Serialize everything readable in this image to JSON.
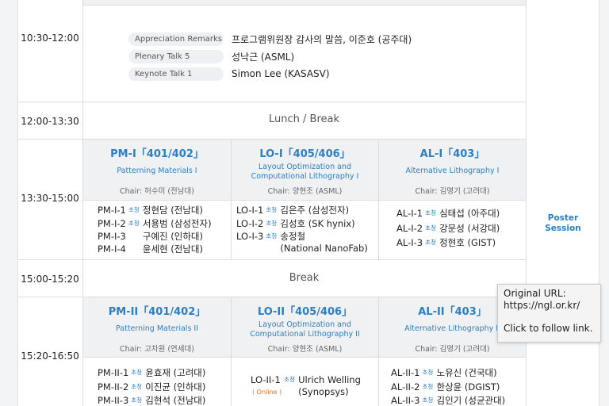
{
  "schedule": {
    "time_plenary": "10:30-12:00",
    "plenary": [
      {
        "label": "Appreciation Remarks",
        "value": "프로그램위원장 감사의 말씀, 이준호 (공주대)"
      },
      {
        "label": "Plenary Talk 5",
        "value": "성낙근 (ASML)"
      },
      {
        "label": "Keynote Talk 1",
        "value": "Simon Lee (KASASV)"
      }
    ],
    "time_lunch": "12:00-13:30",
    "lunch_label": "Lunch / Break",
    "time_s1": "13:30-15:00",
    "time_break": "15:00-15:20",
    "break_label": "Break",
    "time_s2": "15:20-16:50",
    "poster_line1": "Poster",
    "poster_line2": "Session",
    "invited_mark": "초청",
    "online_mark": "( Online )",
    "s1": [
      {
        "title": "PM-I「401/402」",
        "sub1": "Patterning Materials I",
        "sub2": "",
        "chair": "Chair: 허수미 (전남대)",
        "talks": [
          {
            "code": "PM-I-1",
            "inv": true,
            "name": "정현담 (전남대)"
          },
          {
            "code": "PM-I-2",
            "inv": true,
            "name": "서용범 (삼성전자)"
          },
          {
            "code": "PM-I-3",
            "inv": false,
            "name": "구예진 (인하대)"
          },
          {
            "code": "PM-I-4",
            "inv": false,
            "name": "윤세현 (전남대)"
          }
        ]
      },
      {
        "title": "LO-I「405/406」",
        "sub1": "Layout Optimization and",
        "sub2": "Computational Lithography I",
        "chair": "Chair: 양현조 (ASML)",
        "talks": [
          {
            "code": "LO-I-1",
            "inv": true,
            "name": "김은주 (삼성전자)"
          },
          {
            "code": "LO-I-2",
            "inv": true,
            "name": "김성호 (SK hynix)"
          },
          {
            "code": "LO-I-3",
            "inv": true,
            "name": "송정철",
            "name2": "(National NanoFab)"
          }
        ]
      },
      {
        "title": "AL-I「403」",
        "sub1": "Alternative Lithography I",
        "sub2": "",
        "chair": "Chair: 김명기 (고려대)",
        "talks": [
          {
            "code": "AL-I-1",
            "inv": true,
            "name": "심태섭 (아주대)"
          },
          {
            "code": "AL-I-2",
            "inv": true,
            "name": "강문성 (서강대)"
          },
          {
            "code": "AL-I-3",
            "inv": true,
            "name": "정현호 (GIST)"
          }
        ]
      }
    ],
    "s2": [
      {
        "title": "PM-II「401/402」",
        "sub1": "Patterning Materials II",
        "sub2": "",
        "chair": "Chair: 고차원 (연세대)",
        "talks": [
          {
            "code": "PM-II-1",
            "inv": true,
            "name": "윤효재 (고려대)"
          },
          {
            "code": "PM-II-2",
            "inv": true,
            "name": "이진균 (인하대)"
          },
          {
            "code": "PM-II-3",
            "inv": true,
            "name": "김현석 (전남대)"
          }
        ]
      },
      {
        "title": "LO-II「405/406」",
        "sub1": "Layout Optimization and",
        "sub2": "Computational Lithography II",
        "chair": "Chair: 양현조 (ASML)",
        "talks": [
          {
            "code": "LO-II-1",
            "inv": true,
            "name": "Ulrich Welling",
            "name2": "(Synopsys)",
            "online": true
          }
        ]
      },
      {
        "title": "AL-II「403」",
        "sub1": "Alternative Lithography II",
        "sub2": "",
        "chair": "Chair: 김명기 (고려대)",
        "talks": [
          {
            "code": "AL-II-1",
            "inv": true,
            "name": "노유신 (건국대)"
          },
          {
            "code": "AL-II-2",
            "inv": true,
            "name": "한상윤 (DGIST)"
          },
          {
            "code": "AL-II-3",
            "inv": true,
            "name": "김인기 (성균관대)"
          }
        ]
      }
    ]
  },
  "tooltip": {
    "line1": "Original URL:",
    "line2": "https://ngl.or.kr/",
    "line3": "Click to follow link."
  }
}
